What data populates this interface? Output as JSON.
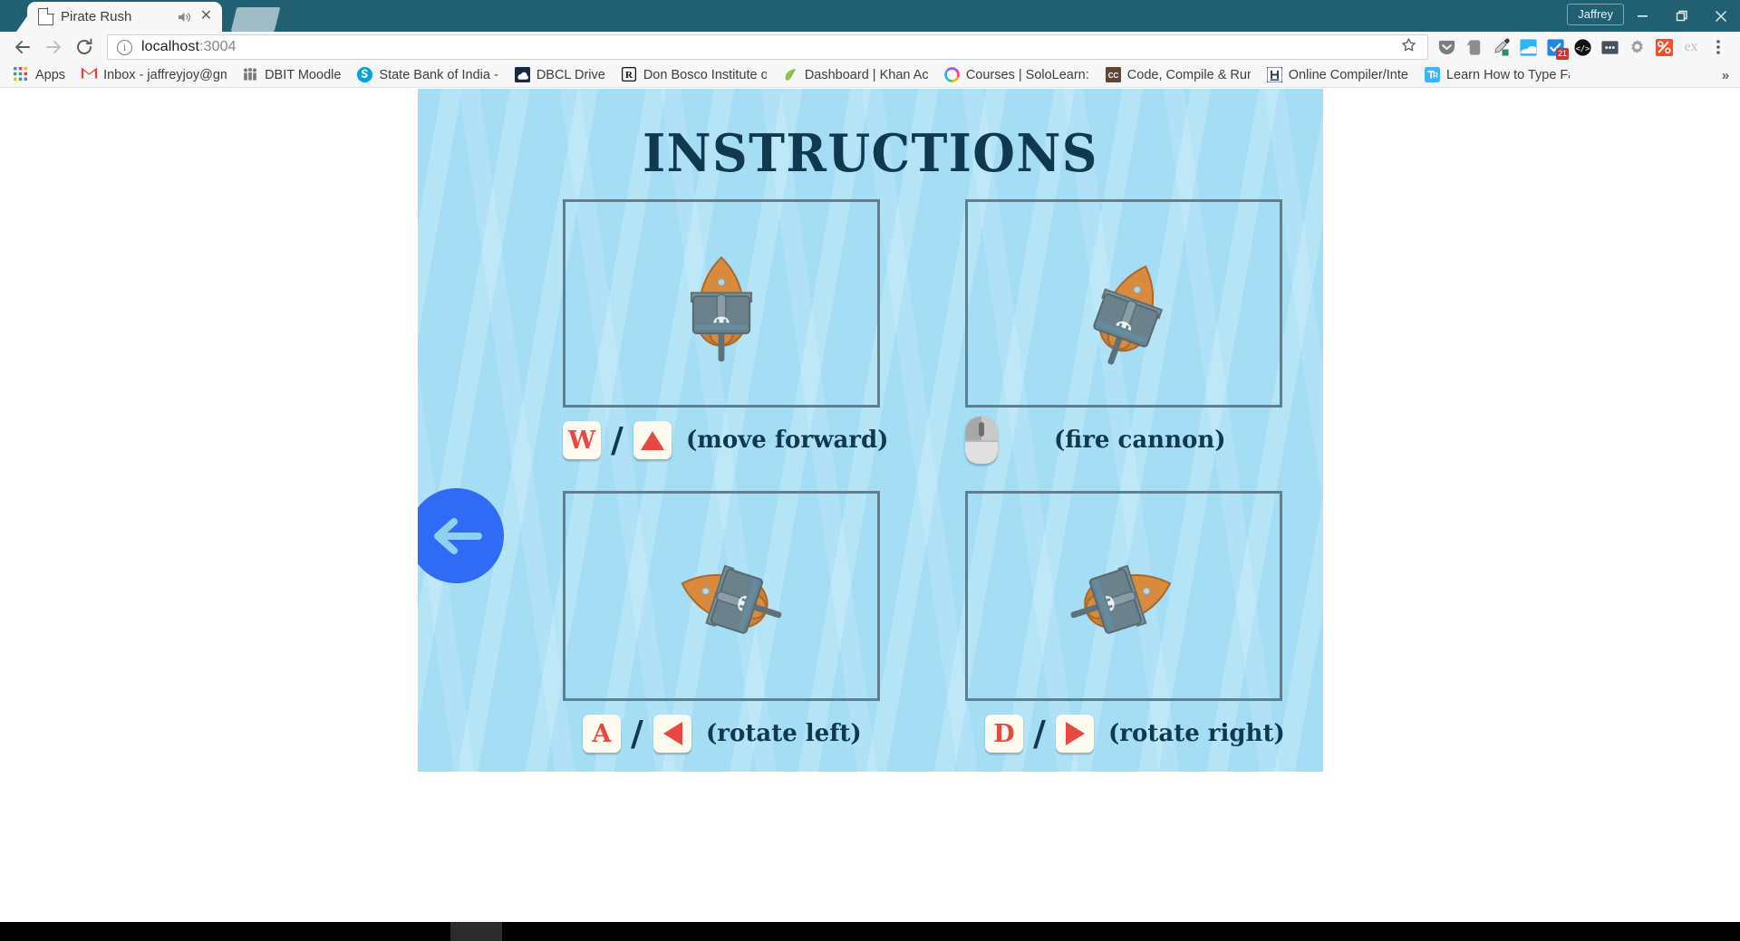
{
  "window": {
    "user_button": "Jaffrey",
    "minimize_icon": "minimize-icon",
    "restore_icon": "restore-icon",
    "close_icon": "close-icon"
  },
  "tab": {
    "title": "Pirate Rush",
    "favicon": "page-icon",
    "audio_icon": "speaker-icon",
    "close_icon": "close-icon"
  },
  "toolbar": {
    "back_icon": "back-arrow-icon",
    "forward_icon": "forward-arrow-icon",
    "reload_icon": "reload-icon",
    "star_icon": "bookmark-star-icon",
    "menu_icon": "three-dot-menu-icon",
    "extensions": [
      {
        "name": "pocket-extension-icon",
        "glyph": "▼",
        "color": "#7d7d7d"
      },
      {
        "name": "evernote-extension-icon",
        "glyph": "🐘",
        "color": "#8e8e8e"
      },
      {
        "name": "colorzilla-eyedropper-icon",
        "glyph": "✐",
        "color": "#4a4a4a"
      },
      {
        "name": "window-resizer-icon",
        "glyph": "▭",
        "color": "#29b6f6"
      },
      {
        "name": "todo-checkbox-icon",
        "glyph": "✓",
        "color": "#1e88e5",
        "badge": "21"
      },
      {
        "name": "code-tag-icon",
        "glyph": "</>",
        "color": "#111111"
      },
      {
        "name": "three-dots-extension-icon",
        "glyph": "•••",
        "color": "#45525c"
      },
      {
        "name": "gear-extension-icon",
        "glyph": "⚙",
        "color": "#9e9e9e"
      },
      {
        "name": "percent-extension-icon",
        "glyph": "%",
        "color": "#ff4b1f"
      },
      {
        "name": "ex-extension-icon",
        "glyph": "ex",
        "color": "#bdbdbd"
      }
    ]
  },
  "omnibox": {
    "info_icon": "info-circle-icon",
    "url_host": "localhost",
    "url_port": ":3004"
  },
  "bookmarks": {
    "overflow_label": "»",
    "items": [
      {
        "label": "Apps",
        "icon": "apps-grid-icon"
      },
      {
        "label": "Inbox - jaffreyjoy@gm",
        "icon": "gmail-icon"
      },
      {
        "label": "DBIT Moodle",
        "icon": "moodle-icon"
      },
      {
        "label": "State Bank of India -",
        "icon": "sbi-icon"
      },
      {
        "label": "DBCL Drive",
        "icon": "drive-icon"
      },
      {
        "label": "Don Bosco Institute o",
        "icon": "dbit-icon"
      },
      {
        "label": "Dashboard | Khan Ac",
        "icon": "khan-academy-icon"
      },
      {
        "label": "Courses | SoloLearn:",
        "icon": "sololearn-icon"
      },
      {
        "label": "Code, Compile & Run",
        "icon": "codechef-icon"
      },
      {
        "label": "Online Compiler/Inte",
        "icon": "hackerearth-icon"
      },
      {
        "label": "Learn How to Type Fa",
        "icon": "typing-icon"
      }
    ]
  },
  "game": {
    "title": "INSTRUCTIONS",
    "back_button": "back-arrow-button",
    "colors": {
      "water": "#a5ddf5",
      "title_navy": "#10394f",
      "panel_border": "#5d7f8e",
      "key_cream": "#fdfaf0",
      "key_red": "#e8483f",
      "back_blue": "#2f6bf5",
      "back_arrow": "#8fd0ef",
      "hull_orange": "#d98a3d",
      "deck_gray": "#6b818c"
    },
    "controls": [
      {
        "id": "move-forward",
        "keys": [
          "W"
        ],
        "separator": "/",
        "arrow": "triangle-up",
        "label": "(move  forward)",
        "ship_rotation": 0
      },
      {
        "id": "fire-cannon",
        "keys": [],
        "separator": "",
        "arrow": "mouse-left-click",
        "label": "(fire cannon)",
        "ship_rotation": 20
      },
      {
        "id": "rotate-left",
        "keys": [
          "A"
        ],
        "separator": "/",
        "arrow": "triangle-left",
        "label": "(rotate left)",
        "ship_rotation": -70
      },
      {
        "id": "rotate-right",
        "keys": [
          "D"
        ],
        "separator": "/",
        "arrow": "triangle-right",
        "label": "(rotate right)",
        "ship_rotation": 70
      }
    ]
  }
}
